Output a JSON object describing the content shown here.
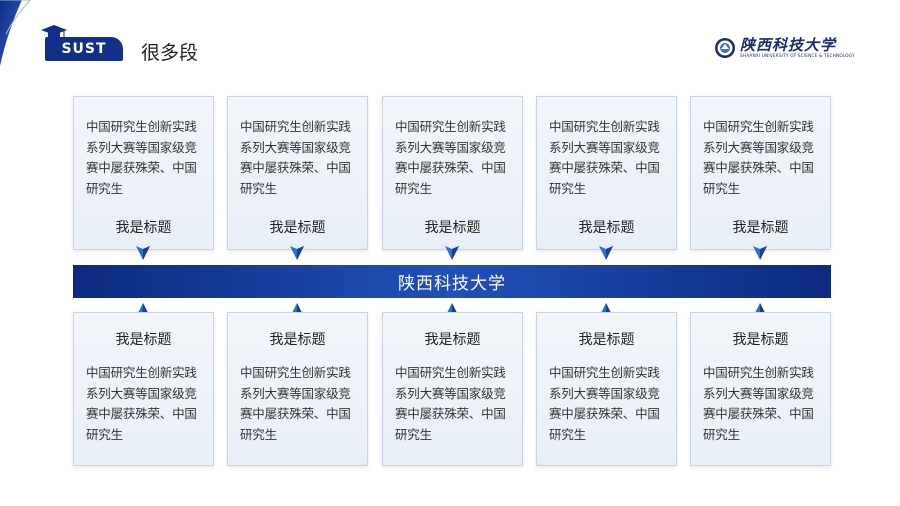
{
  "header": {
    "badge": "SUST",
    "title": "很多段",
    "logo_cn": "陕西科技大学",
    "logo_en": "SHAANXI UNIVERSITY OF SCIENCE & TECHNOLOGY"
  },
  "center_bar": "陕西科技大学",
  "cards_top": [
    {
      "body": "中国研究生创新实践系列大赛等国家级竞赛中屡获殊荣、中国研究生",
      "title": "我是标题"
    },
    {
      "body": "中国研究生创新实践系列大赛等国家级竞赛中屡获殊荣、中国研究生",
      "title": "我是标题"
    },
    {
      "body": "中国研究生创新实践系列大赛等国家级竞赛中屡获殊荣、中国研究生",
      "title": "我是标题"
    },
    {
      "body": "中国研究生创新实践系列大赛等国家级竞赛中屡获殊荣、中国研究生",
      "title": "我是标题"
    },
    {
      "body": "中国研究生创新实践系列大赛等国家级竞赛中屡获殊荣、中国研究生",
      "title": "我是标题"
    }
  ],
  "cards_bottom": [
    {
      "body": "中国研究生创新实践系列大赛等国家级竞赛中屡获殊荣、中国研究生",
      "title": "我是标题"
    },
    {
      "body": "中国研究生创新实践系列大赛等国家级竞赛中屡获殊荣、中国研究生",
      "title": "我是标题"
    },
    {
      "body": "中国研究生创新实践系列大赛等国家级竞赛中屡获殊荣、中国研究生",
      "title": "我是标题"
    },
    {
      "body": "中国研究生创新实践系列大赛等国家级竞赛中屡获殊荣、中国研究生",
      "title": "我是标题"
    },
    {
      "body": "中国研究生创新实践系列大赛等国家级竞赛中屡获殊荣、中国研究生",
      "title": "我是标题"
    }
  ],
  "colors": {
    "brand": "#122f8a",
    "bar": "#1a3c9c",
    "card_bg": "#eef2f8",
    "arrow": "#2a6fd6"
  }
}
